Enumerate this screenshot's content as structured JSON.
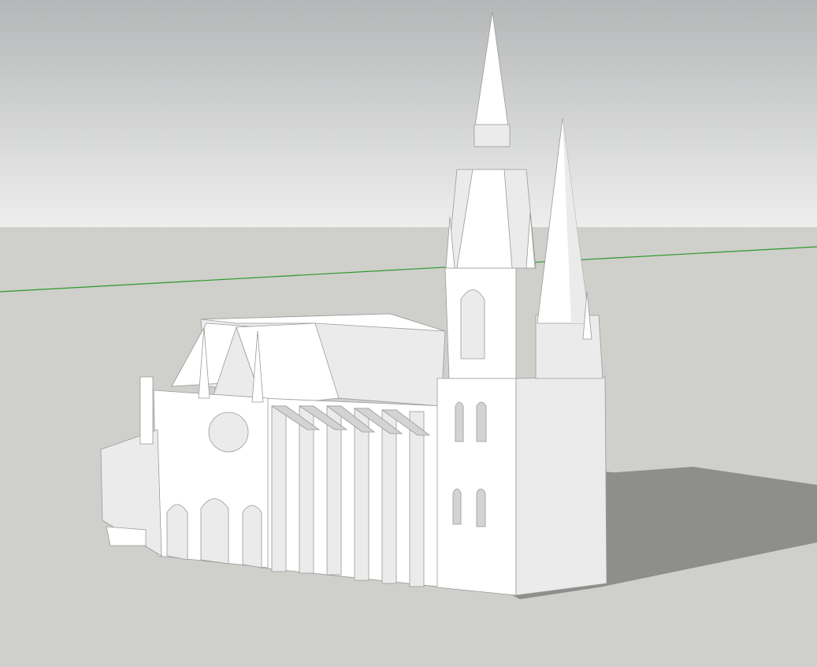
{
  "viewport": {
    "colors": {
      "sky_top": "#b4b6b7",
      "sky_bottom": "#eeeeee",
      "ground": "#cfcfcc",
      "axis_green": "#2b9a2b",
      "shadow": "#8e8e8c",
      "model_light": "#ffffff",
      "model_mid": "#ebebeb",
      "model_dark": "#d3d3d3",
      "edge": "#9a9a9a"
    },
    "model": {
      "name": "cathedral-3d-model",
      "material": "default-white"
    }
  }
}
